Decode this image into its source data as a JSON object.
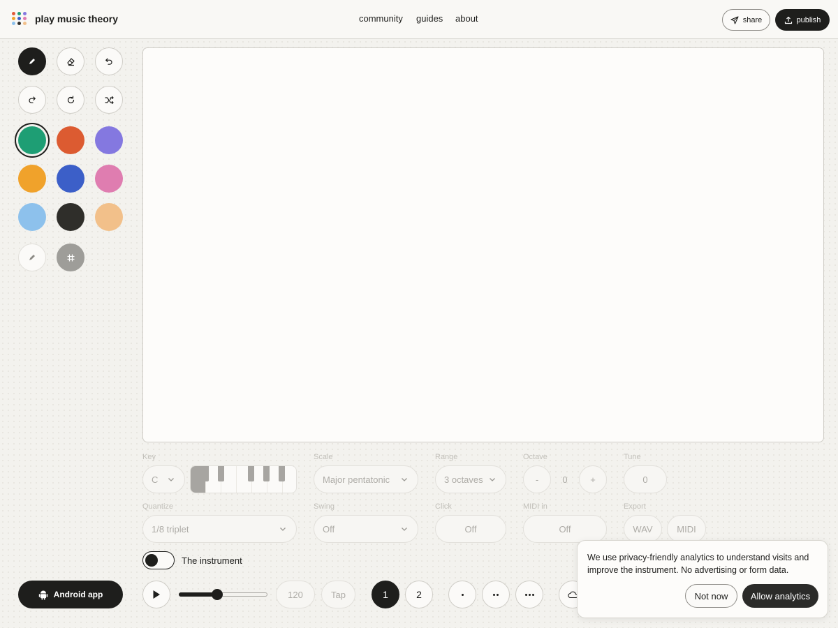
{
  "header": {
    "brand": "play music theory",
    "nav": [
      "community",
      "guides",
      "about"
    ],
    "share_label": "share",
    "publish_label": "publish"
  },
  "tools": [
    "pencil-icon",
    "eraser-icon",
    "undo-icon",
    "redo-icon",
    "reset-icon",
    "shuffle-icon"
  ],
  "colors": {
    "selected": "#1e9e74",
    "palette": [
      "#1e9e74",
      "#dc5b31",
      "#8478e0",
      "#f0a22b",
      "#3c5fc8",
      "#df7db0",
      "#8dc1ec",
      "#2f2e2a",
      "#f2c08a"
    ]
  },
  "controls": {
    "key": {
      "label": "Key",
      "value": "C"
    },
    "scale": {
      "label": "Scale",
      "value": "Major pentatonic"
    },
    "range": {
      "label": "Range",
      "value": "3 octaves"
    },
    "octave": {
      "label": "Octave",
      "minus": "-",
      "value": "0",
      "plus": "+"
    },
    "tune": {
      "label": "Tune",
      "value": "0"
    },
    "quantize": {
      "label": "Quantize",
      "value": "1/8 triplet"
    },
    "swing": {
      "label": "Swing",
      "value": "Off"
    },
    "click": {
      "label": "Click",
      "value": "Off"
    },
    "midi_in": {
      "label": "MIDI in",
      "value": "Off"
    },
    "export": {
      "label": "Export",
      "wav": "WAV",
      "midi": "MIDI"
    }
  },
  "instrument_toggle": {
    "label": "The instrument",
    "on": false
  },
  "android_label": "Android app",
  "transport": {
    "tempo": "120",
    "tap_label": "Tap",
    "volume_fraction": 0.43,
    "pages": [
      "1",
      "2"
    ]
  },
  "consent": {
    "message": "We use privacy-friendly analytics to understand visits and improve the instrument. No advertising or form data.",
    "decline_label": "Not now",
    "accept_label": "Allow analytics"
  }
}
